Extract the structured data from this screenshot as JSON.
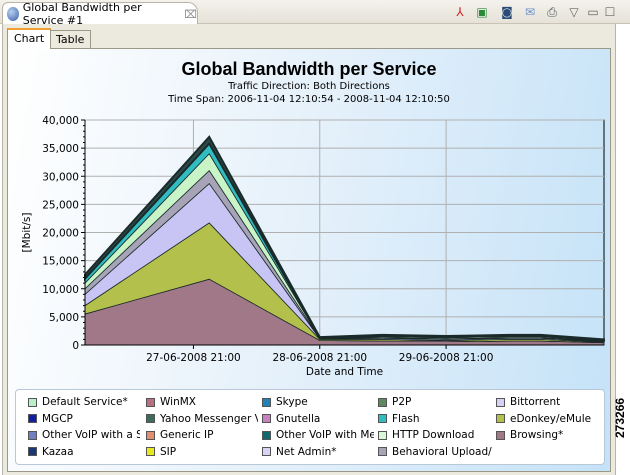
{
  "window": {
    "tab_title": "Global Bandwidth per Service #1",
    "close": "⌧"
  },
  "toolbar": [
    {
      "name": "pdf-export-icon",
      "glyph": "⅄",
      "color": "#d02020"
    },
    {
      "name": "excel-export-icon",
      "glyph": "▣",
      "color": "#2a8a3a"
    },
    {
      "name": "camera-icon",
      "glyph": "◙",
      "color": "#2a4a78"
    },
    {
      "name": "mail-icon",
      "glyph": "✉",
      "color": "#6a90c8"
    },
    {
      "name": "print-icon",
      "glyph": "⎙",
      "color": "#505860"
    },
    {
      "name": "view-menu-icon",
      "glyph": "▽",
      "color": "#666"
    },
    {
      "name": "minimize-icon",
      "glyph": "▭",
      "color": "#666"
    },
    {
      "name": "maximize-icon",
      "glyph": "☐",
      "color": "#666"
    }
  ],
  "tabs": {
    "chart": "Chart",
    "table": "Table"
  },
  "figure_id": "273266",
  "chart_data": {
    "type": "area",
    "stacked": true,
    "title": "Global Bandwidth per Service",
    "subtitle1": "Traffic Direction: Both Directions",
    "subtitle2": "Time Span: 2006-11-04 12:10:54 - 2008-11-04 12:10:50",
    "xlabel": "Date and Time",
    "ylabel": "[Mbit/s]",
    "ylim": [
      0,
      40000
    ],
    "yticks": [
      "0",
      "5,000",
      "10,000",
      "15,000",
      "20,000",
      "25,000",
      "30,000",
      "35,000",
      "40,000"
    ],
    "x_hours_from_first_tick": [
      -20.6,
      3,
      24,
      36,
      48,
      54,
      60,
      66,
      78
    ],
    "xlim_hours": [
      -20.6,
      78
    ],
    "xticks": [
      {
        "hours": 0,
        "label": "27-06-2008 21:00"
      },
      {
        "hours": 24,
        "label": "28-06-2008 21:00"
      },
      {
        "hours": 48,
        "label": "29-06-2008 21:00"
      }
    ],
    "grid": true,
    "series": [
      {
        "name": "Browsing*",
        "color": "#a07888",
        "values": [
          5500,
          11700,
          800,
          700,
          700,
          600,
          700,
          700,
          400
        ]
      },
      {
        "name": "eDonkey/eMule",
        "color": "#b4c04c",
        "values": [
          1500,
          10000,
          200,
          300,
          100,
          300,
          300,
          300,
          100
        ]
      },
      {
        "name": "Net Admin*",
        "color": "#c8c4f4",
        "values": [
          2000,
          7000,
          100,
          200,
          200,
          200,
          200,
          200,
          100
        ]
      },
      {
        "name": "Behavioral Upload/D",
        "color": "#a8a4b8",
        "values": [
          1000,
          2300,
          50,
          100,
          100,
          100,
          100,
          100,
          50
        ]
      },
      {
        "name": "HTTP Download",
        "color": "#c8f4c8",
        "values": [
          1000,
          3000,
          50,
          200,
          200,
          200,
          200,
          200,
          100
        ]
      },
      {
        "name": "Flash",
        "color": "#30bcc0",
        "values": [
          800,
          1800,
          50,
          100,
          100,
          100,
          100,
          100,
          50
        ]
      },
      {
        "name": "Other",
        "color": "#2c4848",
        "values": [
          700,
          1200,
          150,
          200,
          200,
          200,
          200,
          200,
          200
        ]
      }
    ],
    "legend": [
      {
        "label": "Default Service*",
        "color": "#b8f0c8"
      },
      {
        "label": "WinMX",
        "color": "#b87080"
      },
      {
        "label": "Skype",
        "color": "#2080b8"
      },
      {
        "label": "P2P",
        "color": "#608860"
      },
      {
        "label": "Bittorrent",
        "color": "#d8d0f4"
      },
      {
        "label": "MGCP",
        "color": "#1020a0"
      },
      {
        "label": "Yahoo Messenger Vc",
        "color": "#3c6c5c"
      },
      {
        "label": "Gnutella",
        "color": "#c880c0"
      },
      {
        "label": "Flash",
        "color": "#30bcc0"
      },
      {
        "label": "eDonkey/eMule",
        "color": "#b4c04c"
      },
      {
        "label": "Other VoIP with a Si",
        "color": "#7080c0"
      },
      {
        "label": "Generic IP",
        "color": "#e09070"
      },
      {
        "label": "Other VoIP with Mec",
        "color": "#106870"
      },
      {
        "label": "HTTP Download",
        "color": "#d8f8d8"
      },
      {
        "label": "Browsing*",
        "color": "#a07888"
      },
      {
        "label": "Kazaa",
        "color": "#183878"
      },
      {
        "label": "SIP",
        "color": "#e8e820"
      },
      {
        "label": "Net Admin*",
        "color": "#d8d4f8"
      },
      {
        "label": "Behavioral Upload/D",
        "color": "#a8a4b8"
      }
    ]
  }
}
